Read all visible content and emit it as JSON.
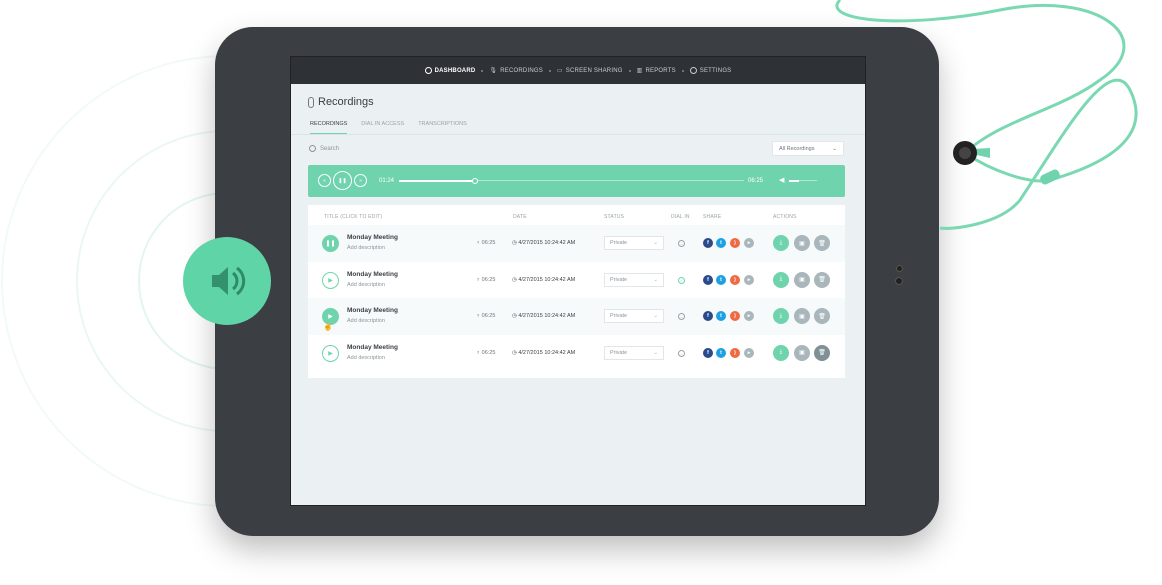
{
  "nav": {
    "items": [
      {
        "label": "DASHBOARD",
        "icon": "dashboard-icon",
        "active": true
      },
      {
        "label": "RECORDINGS",
        "icon": "mic-icon"
      },
      {
        "label": "SCREEN SHARING",
        "icon": "monitor-icon"
      },
      {
        "label": "REPORTS",
        "icon": "reports-icon"
      },
      {
        "label": "SETTINGS",
        "icon": "gear-icon"
      }
    ]
  },
  "page": {
    "title": "Recordings",
    "tabs": [
      "RECORDINGS",
      "DIAL IN ACCESS",
      "TRANSCRIPTIONS"
    ],
    "active_tab": "RECORDINGS"
  },
  "search": {
    "placeholder": "Search"
  },
  "filter": {
    "value": "All Recordings"
  },
  "player": {
    "current": "01:24",
    "total": "06:25",
    "progress": 0.22,
    "volume": 0.35
  },
  "table": {
    "headers": {
      "title": "TITLE (CLICK TO EDIT)",
      "date": "DATE",
      "status": "STATUS",
      "dial": "DIAL IN",
      "share": "SHARE",
      "actions": "ACTIONS"
    },
    "rows": [
      {
        "title": "Monday Meeting",
        "desc": "Add description",
        "duration": "06:25",
        "date": "4/27/2015 10:24:42 AM",
        "status": "Private",
        "dial_in": false,
        "playing": true
      },
      {
        "title": "Monday Meeting",
        "desc": "Add description",
        "duration": "06:25",
        "date": "4/27/2015 10:24:42 AM",
        "status": "Private",
        "dial_in": true,
        "playing": false
      },
      {
        "title": "Monday Meeting",
        "desc": "Add description",
        "duration": "06:25",
        "date": "4/27/2015 10:24:42 AM",
        "status": "Private",
        "dial_in": false,
        "playing": false,
        "hover": true
      },
      {
        "title": "Monday Meeting",
        "desc": "Add description",
        "duration": "06:25",
        "date": "4/27/2015 10:24:42 AM",
        "status": "Private",
        "dial_in": false,
        "playing": false
      }
    ]
  },
  "colors": {
    "accent": "#6fd4ad",
    "facebook": "#2b4a8a",
    "twitter": "#1da1e2",
    "rss": "#ee6a43",
    "grey": "#a9b6bb",
    "frame": "#3b3e42"
  }
}
